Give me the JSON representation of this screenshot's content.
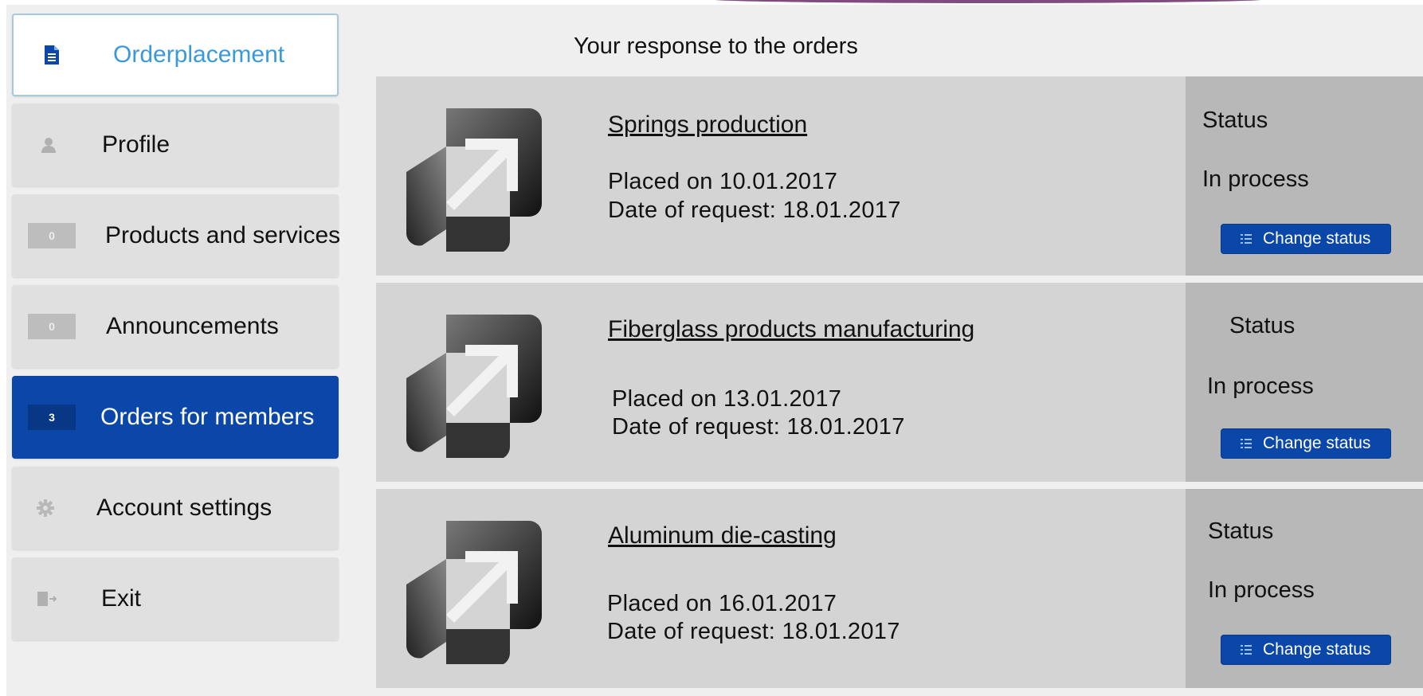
{
  "sidebar": {
    "items": [
      {
        "label": "Orderplacement",
        "icon": "document-icon"
      },
      {
        "label": "Profile",
        "icon": "user-icon"
      },
      {
        "label": "Products and services",
        "badge": "0"
      },
      {
        "label": "Announcements",
        "badge": "0"
      },
      {
        "label": "Orders for members",
        "badge": "3",
        "active": true
      },
      {
        "label": "Account settings",
        "icon": "gear-icon"
      },
      {
        "label": "Exit",
        "icon": "exit-icon"
      }
    ]
  },
  "main": {
    "title": "Your response to the orders",
    "orders": [
      {
        "title": "Springs production",
        "placed": "Placed on 10.01.2017",
        "requested": "Date of request: 18.01.2017",
        "status_label": "Status",
        "status_value": "In process",
        "button_label": "Change status"
      },
      {
        "title": "Fiberglass products manufacturing",
        "placed": "Placed on 13.01.2017",
        "requested": "Date of request: 18.01.2017",
        "status_label": "Status",
        "status_value": "In process",
        "button_label": "Change status"
      },
      {
        "title": "Aluminum die-casting",
        "placed": "Placed on 16.01.2017",
        "requested": "Date of request: 18.01.2017",
        "status_label": "Status",
        "status_value": "In process",
        "button_label": "Change status"
      }
    ]
  },
  "colors": {
    "accent": "#0a47a9",
    "header_text": "#3a9ad9",
    "card_bg": "#d4d4d4",
    "status_bg": "#b8b8b8"
  }
}
